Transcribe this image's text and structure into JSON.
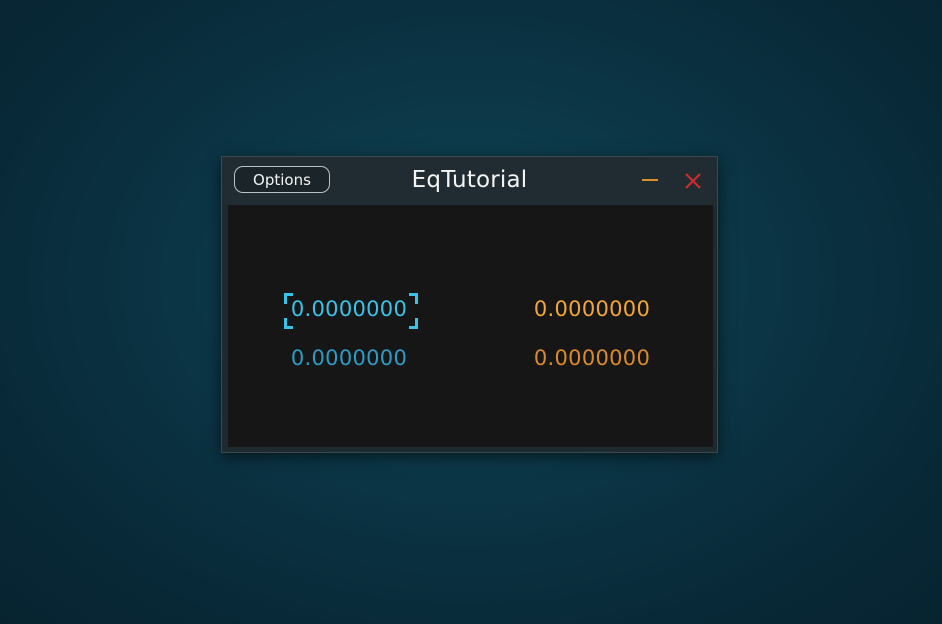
{
  "window": {
    "title": "EqTutorial",
    "options_label": "Options"
  },
  "values": {
    "left_top": "0.0000000",
    "left_bottom": "0.0000000",
    "right_top": "0.0000000",
    "right_bottom": "0.0000000"
  },
  "colors": {
    "accent_blue": "#3cc2e6",
    "secondary_blue": "#2d9bc4",
    "accent_orange": "#f2a53a",
    "secondary_orange": "#d98a2e",
    "close_red": "#d12a2a",
    "minimize_orange": "#d98f2a"
  },
  "icons": {
    "minimize": "minimize-icon",
    "close": "close-icon"
  }
}
